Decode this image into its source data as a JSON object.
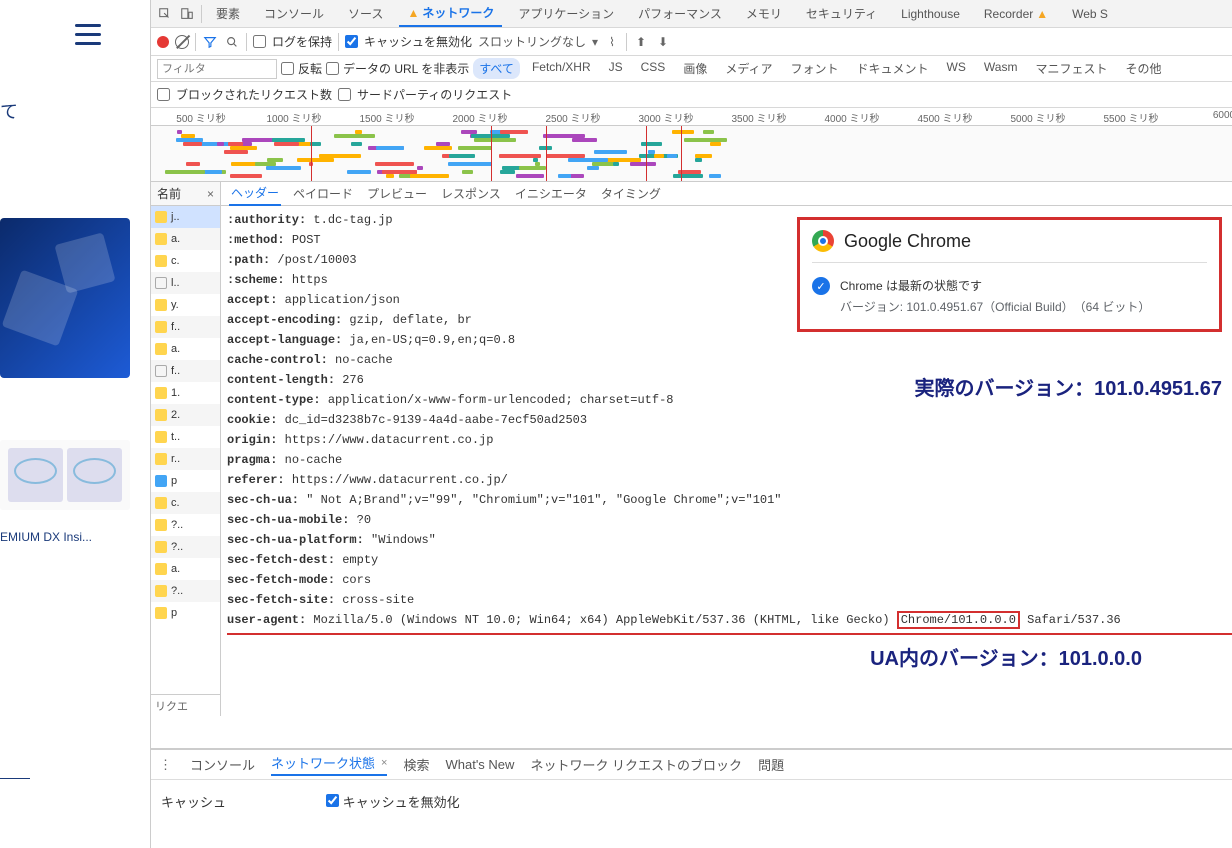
{
  "left": {
    "text": "て",
    "caption": "EMIUM DX Insi..."
  },
  "toolbar": {
    "tabs": [
      "要素",
      "コンソール",
      "ソース",
      "ネットワーク",
      "アプリケーション",
      "パフォーマンス",
      "メモリ",
      "セキュリティ",
      "Lighthouse",
      "Recorder",
      "Web S"
    ],
    "active": "ネットワーク",
    "preserve_log": "ログを保持",
    "disable_cache": "キャッシュを無効化",
    "throttle": "スロットリングなし"
  },
  "filter": {
    "placeholder": "フィルタ",
    "invert": "反転",
    "hide_data_url": "データの URL を非表示",
    "types": [
      "すべて",
      "Fetch/XHR",
      "JS",
      "CSS",
      "画像",
      "メディア",
      "フォント",
      "ドキュメント",
      "WS",
      "Wasm",
      "マニフェスト",
      "その他"
    ],
    "active_type": "すべて",
    "blocked_req": "ブロックされたリクエスト数",
    "third_party": "サードパーティのリクエスト"
  },
  "ruler": {
    "ticks": [
      "500 ミリ秒",
      "1000 ミリ秒",
      "1500 ミリ秒",
      "2000 ミリ秒",
      "2500 ミリ秒",
      "3000 ミリ秒",
      "3500 ミリ秒",
      "4000 ミリ秒",
      "4500 ミリ秒",
      "5000 ミリ秒",
      "5500 ミリ秒",
      "6000"
    ]
  },
  "namecol": {
    "header": "名前",
    "items": [
      "j..",
      "a.",
      "c.",
      "l..",
      "y.",
      "f..",
      "a.",
      "f..",
      "1.",
      "2.",
      "t..",
      "r..",
      "p",
      "c.",
      "?..",
      "?..",
      "a.",
      "?..",
      "p"
    ],
    "footer": "リクエ"
  },
  "detail_tabs": [
    "ヘッダー",
    "ペイロード",
    "プレビュー",
    "レスポンス",
    "イニシエータ",
    "タイミング"
  ],
  "detail_active": "ヘッダー",
  "headers": [
    {
      "k": ":authority:",
      "v": "t.dc-tag.jp"
    },
    {
      "k": ":method:",
      "v": "POST"
    },
    {
      "k": ":path:",
      "v": "/post/10003"
    },
    {
      "k": ":scheme:",
      "v": "https"
    },
    {
      "k": "accept:",
      "v": "application/json"
    },
    {
      "k": "accept-encoding:",
      "v": "gzip, deflate, br"
    },
    {
      "k": "accept-language:",
      "v": "ja,en-US;q=0.9,en;q=0.8"
    },
    {
      "k": "cache-control:",
      "v": "no-cache"
    },
    {
      "k": "content-length:",
      "v": "276"
    },
    {
      "k": "content-type:",
      "v": "application/x-www-form-urlencoded; charset=utf-8"
    },
    {
      "k": "cookie:",
      "v": "dc_id=d3238b7c-9139-4a4d-aabe-7ecf50ad2503"
    },
    {
      "k": "origin:",
      "v": "https://www.datacurrent.co.jp"
    },
    {
      "k": "pragma:",
      "v": "no-cache"
    },
    {
      "k": "referer:",
      "v": "https://www.datacurrent.co.jp/"
    },
    {
      "k": "sec-ch-ua:",
      "v": "\" Not A;Brand\";v=\"99\", \"Chromium\";v=\"101\", \"Google Chrome\";v=\"101\""
    },
    {
      "k": "sec-ch-ua-mobile:",
      "v": "?0"
    },
    {
      "k": "sec-ch-ua-platform:",
      "v": "\"Windows\""
    },
    {
      "k": "sec-fetch-dest:",
      "v": "empty"
    },
    {
      "k": "sec-fetch-mode:",
      "v": "cors"
    },
    {
      "k": "sec-fetch-site:",
      "v": "cross-site"
    }
  ],
  "ua": {
    "k": "user-agent:",
    "prefix": "Mozilla/5.0 (Windows NT 10.0; Win64; x64) AppleWebKit/537.36 (KHTML, like Gecko) ",
    "boxed": "Chrome/101.0.0.0",
    "suffix": " Safari/537.36"
  },
  "chrome": {
    "title": "Google Chrome",
    "status": "Chrome は最新の状態です",
    "version": "バージョン: 101.0.4951.67（Official Build）　（64 ビット）"
  },
  "anno": {
    "real": "実際のバージョン：101.0.4951.67",
    "ua": "UA内のバージョン：101.0.0.0"
  },
  "drawer": {
    "tabs": [
      "コンソール",
      "ネットワーク状態",
      "検索",
      "What's New",
      "ネットワーク リクエストのブロック",
      "問題"
    ],
    "active": "ネットワーク状態",
    "cache_label": "キャッシュ",
    "disable_cache": "キャッシュを無効化"
  }
}
